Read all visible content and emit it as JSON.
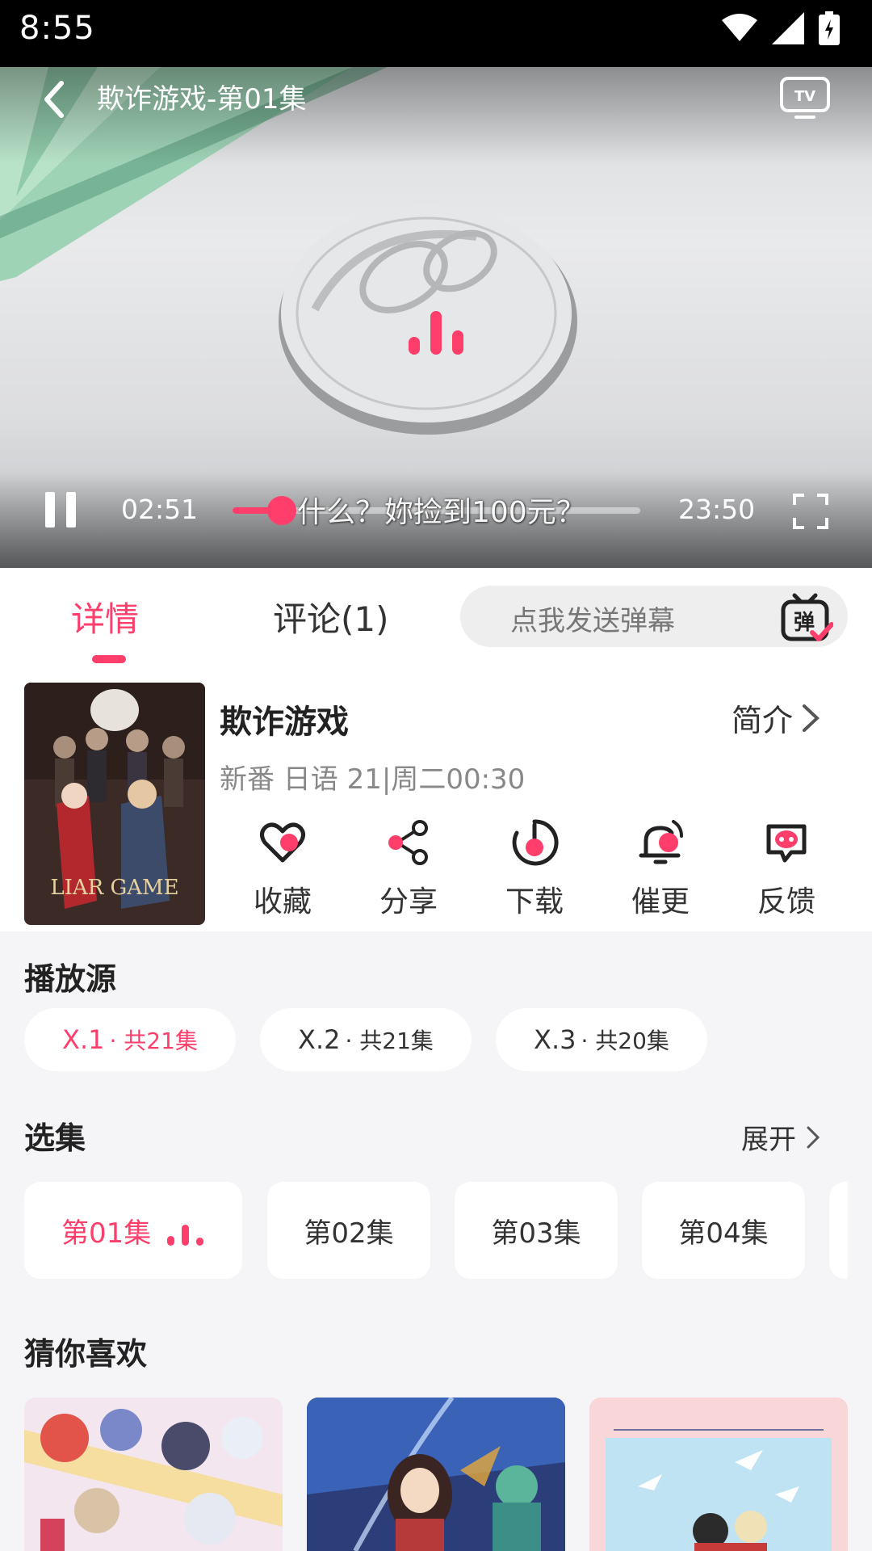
{
  "status_bar": {
    "time": "8:55"
  },
  "player": {
    "title": "欺诈游戏-第01集",
    "current_time": "02:51",
    "total_time": "23:50",
    "subtitle": "什么？妳捡到100元？",
    "progress": 0.12,
    "accent": "#ff3e6c"
  },
  "tabs": {
    "detail": "详情",
    "comment": "评论(1)",
    "danmaku_placeholder": "点我发送弹幕"
  },
  "show": {
    "title": "欺诈游戏",
    "intro_label": "简介",
    "meta": "新番 日语 21|周二00:30",
    "cover_text": "LIAR GAME"
  },
  "actions": [
    {
      "label": "收藏",
      "icon": "heart-icon"
    },
    {
      "label": "分享",
      "icon": "share-icon"
    },
    {
      "label": "下载",
      "icon": "download-icon"
    },
    {
      "label": "催更",
      "icon": "bell-icon"
    },
    {
      "label": "反馈",
      "icon": "feedback-icon"
    }
  ],
  "sources": {
    "title": "播放源",
    "items": [
      {
        "name": "X.1",
        "count": " · 共21集"
      },
      {
        "name": "X.2",
        "count": " · 共21集"
      },
      {
        "name": "X.3",
        "count": " · 共20集"
      }
    ]
  },
  "episodes": {
    "title": "选集",
    "expand_label": "展开",
    "items": [
      "第01集",
      "第02集",
      "第03集",
      "第04集"
    ]
  },
  "recommend": {
    "title": "猜你喜欢"
  }
}
